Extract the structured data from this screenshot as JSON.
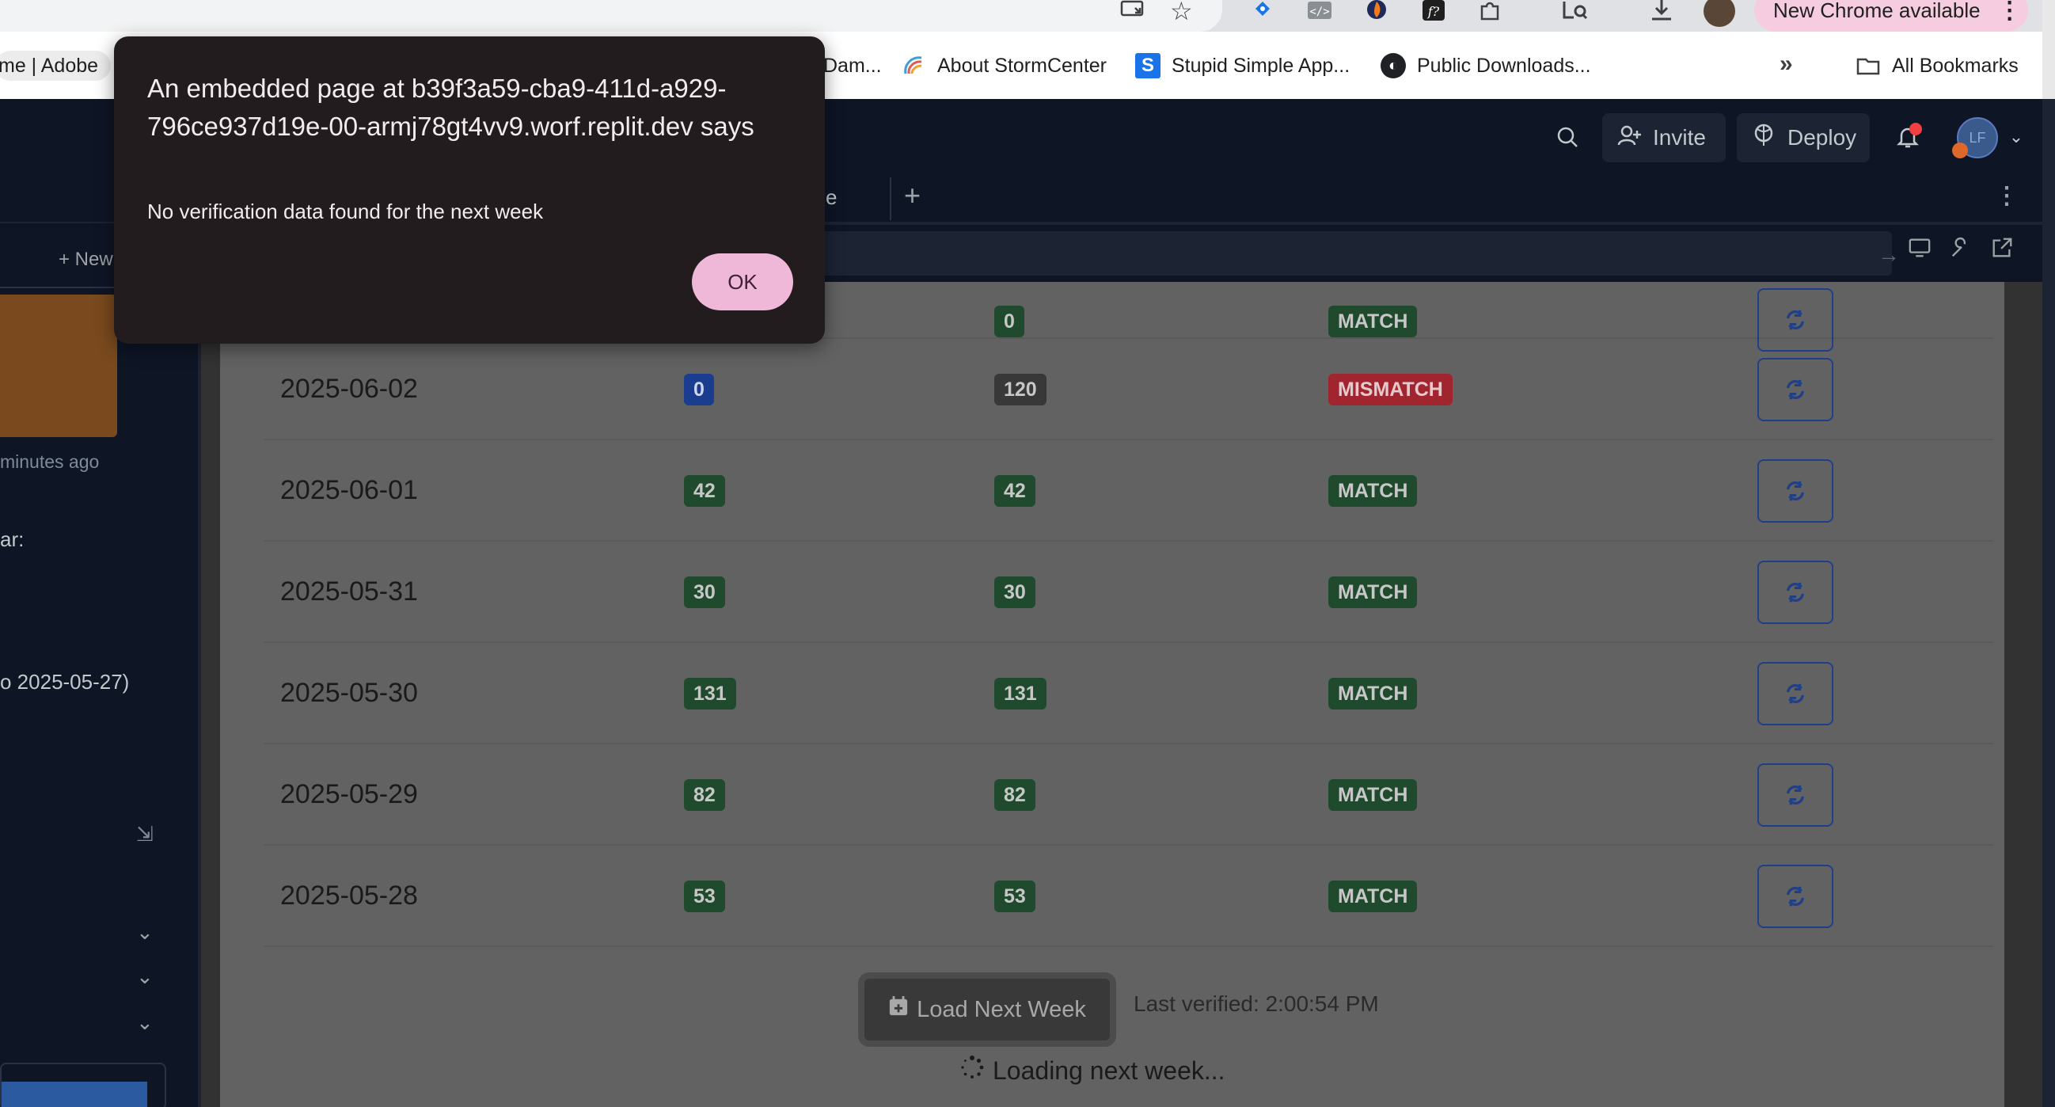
{
  "chrome": {
    "update_label": "New Chrome available",
    "menu_glyph": "⋮"
  },
  "bookmarks": [
    {
      "label": "me | Adobe"
    },
    {
      "label": "Dam..."
    },
    {
      "label": "About StormCenter"
    },
    {
      "label": "Stupid Simple App..."
    },
    {
      "label": "Public Downloads..."
    }
  ],
  "all_bookmarks": "All Bookmarks",
  "overflow": "»",
  "replit": {
    "invite": "Invite",
    "deploy": "Deploy",
    "avatar_initials": "LF",
    "tab_fragment": "ce"
  },
  "sidebar": {
    "new_label": "+ New",
    "time_ago": "minutes ago",
    "frag_1": "ar:",
    "frag_2": "o 2025-05-27)"
  },
  "verification": {
    "rows": [
      {
        "date": "2025-06-02",
        "a": "0",
        "b": "120",
        "status": "MISMATCH"
      },
      {
        "date": "2025-06-01",
        "a": "42",
        "b": "42",
        "status": "MATCH"
      },
      {
        "date": "2025-05-31",
        "a": "30",
        "b": "30",
        "status": "MATCH"
      },
      {
        "date": "2025-05-30",
        "a": "131",
        "b": "131",
        "status": "MATCH"
      },
      {
        "date": "2025-05-29",
        "a": "82",
        "b": "82",
        "status": "MATCH"
      },
      {
        "date": "2025-05-28",
        "a": "53",
        "b": "53",
        "status": "MATCH"
      }
    ],
    "partial_row": {
      "a": "0",
      "status": "MATCH"
    },
    "load_next_week": "Load Next Week",
    "last_verified": "Last verified: 2:00:54 PM",
    "loading_text": "Loading next week..."
  },
  "dialog": {
    "title": "An embedded page at b39f3a59-cba9-411d-a929-796ce937d19e-00-armj78gt4vv9.worf.replit.dev says",
    "message": "No verification data found for the next week",
    "ok": "OK"
  },
  "colors": {
    "match": "#204a2e",
    "mismatch": "#a1252f",
    "count_a_highlight": "#1a3d8f",
    "dialog_bg": "#221c1e",
    "ok_button": "#f0b8d8"
  }
}
